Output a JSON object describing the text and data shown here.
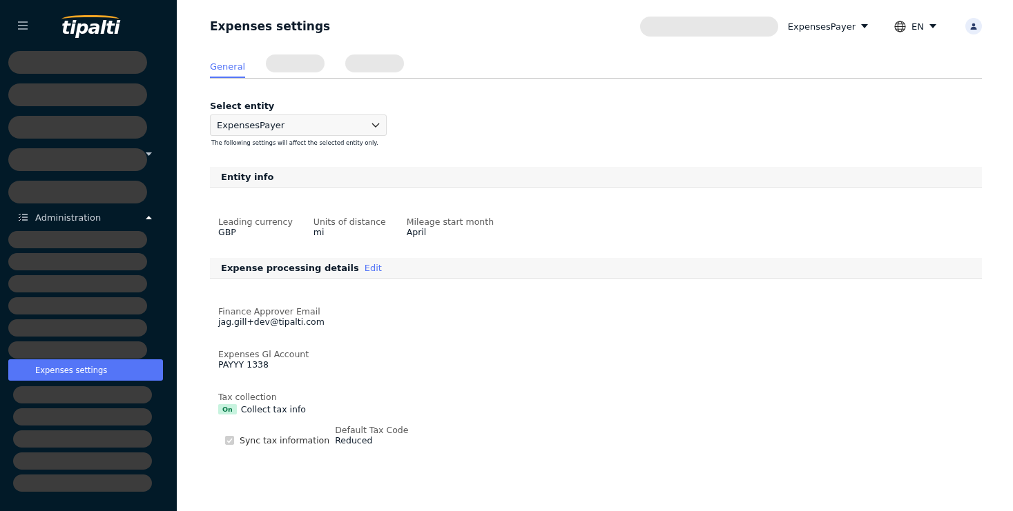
{
  "sidebar": {
    "logo": "tipalti",
    "items": [
      {
        "kind": "tallblock"
      },
      {
        "kind": "tallblock"
      },
      {
        "kind": "tallblock"
      },
      {
        "kind": "tallblock",
        "expandable": true
      },
      {
        "kind": "tallblock"
      },
      {
        "kind": "group",
        "label": "Administration",
        "expanded": true
      },
      {
        "kind": "slimblock"
      },
      {
        "kind": "slimblock"
      },
      {
        "kind": "slimblock"
      },
      {
        "kind": "slimblock"
      },
      {
        "kind": "slimblock"
      },
      {
        "kind": "slimblock"
      },
      {
        "kind": "link",
        "label": "Expenses settings",
        "selected": true
      },
      {
        "kind": "subblock"
      },
      {
        "kind": "subblock"
      },
      {
        "kind": "subblock"
      },
      {
        "kind": "subblock"
      },
      {
        "kind": "subblock"
      }
    ]
  },
  "header": {
    "title": "Expenses settings",
    "entity": "ExpensesPayer",
    "language": "EN"
  },
  "tabs": [
    {
      "kind": "text",
      "label": "General",
      "selected": true
    },
    {
      "kind": "redacted",
      "selected": false
    },
    {
      "kind": "redacted",
      "selected": false
    }
  ],
  "entity_select": {
    "label": "Select entity",
    "value": "ExpensesPayer",
    "hint": "The following settings will affect the selected entity only."
  },
  "entity_info": {
    "title": "Entity info",
    "fields": [
      {
        "label": "Leading currency",
        "value": "GBP"
      },
      {
        "label": "Units of distance",
        "value": "mi"
      },
      {
        "label": "Mileage start month",
        "value": "April"
      }
    ]
  },
  "processing": {
    "title": "Expense processing details",
    "edit": "Edit",
    "fields": [
      {
        "label": "Finance Approver Email",
        "value": "jag.gill+dev@tipalti.com"
      },
      {
        "label": "Expenses Gl Account",
        "value": "PAYYY 1338"
      }
    ],
    "tax": {
      "label": "Tax collection",
      "badge": "On",
      "on": true,
      "text": "Collect tax info",
      "sync": {
        "label": "Sync tax information",
        "checked": true,
        "disabled": true
      },
      "code": {
        "label": "Default Tax Code",
        "value": "Reduced"
      }
    }
  }
}
